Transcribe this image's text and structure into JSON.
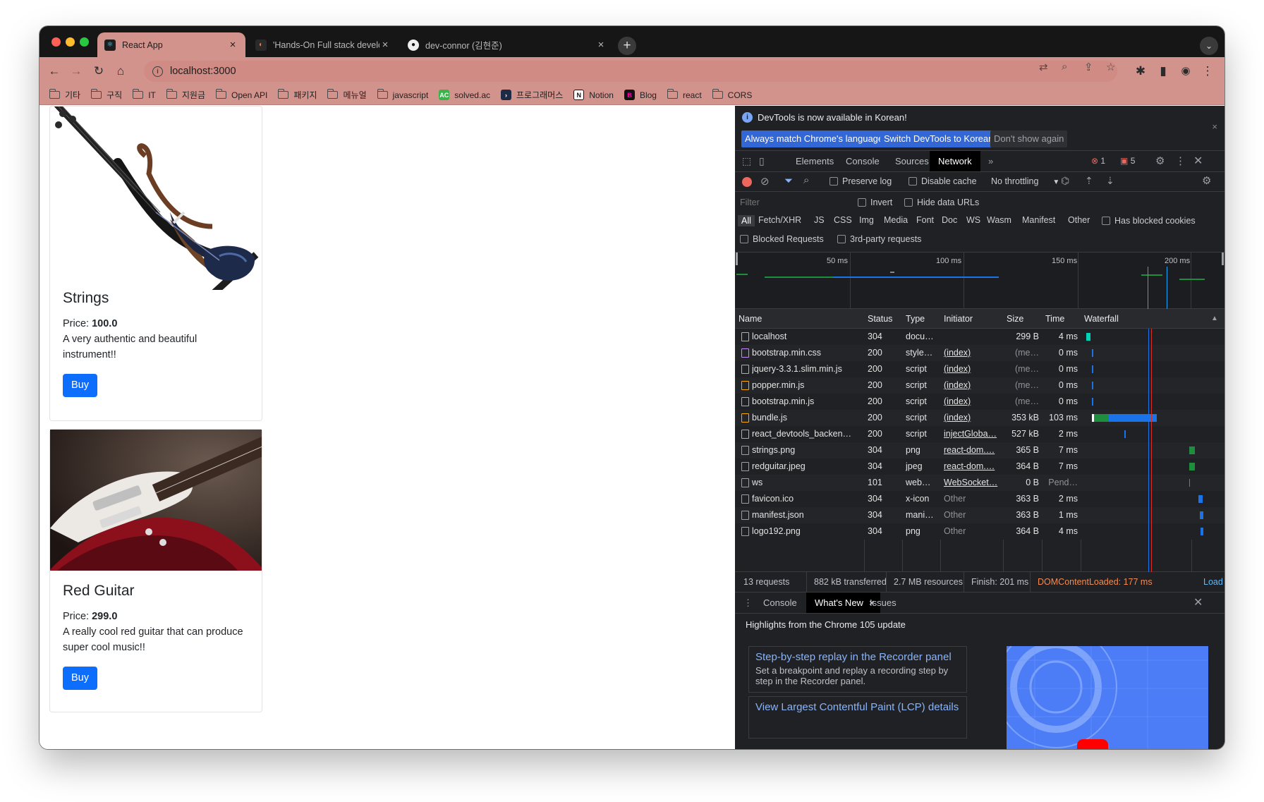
{
  "browser": {
    "tabs": [
      {
        "title": "React App",
        "active": true
      },
      {
        "title": "'Hands-On Full stack developm",
        "active": false
      },
      {
        "title": "dev-connor (김현준)",
        "active": false
      }
    ],
    "address": "localhost:3000",
    "bookmarks": [
      {
        "label": "기타",
        "icon": "folder-icon"
      },
      {
        "label": "구직",
        "icon": "folder-icon"
      },
      {
        "label": "IT",
        "icon": "folder-icon"
      },
      {
        "label": "지원금",
        "icon": "folder-icon"
      },
      {
        "label": "Open API",
        "icon": "folder-icon"
      },
      {
        "label": "패키지",
        "icon": "folder-icon"
      },
      {
        "label": "메뉴얼",
        "icon": "folder-icon"
      },
      {
        "label": "javascript",
        "icon": "folder-icon"
      },
      {
        "label": "solved.ac",
        "icon": "solvedac-icon"
      },
      {
        "label": "프로그래머스",
        "icon": "programmers-icon"
      },
      {
        "label": "Notion",
        "icon": "notion-icon"
      },
      {
        "label": "Blog",
        "icon": "blog-icon"
      },
      {
        "label": "react",
        "icon": "folder-icon"
      },
      {
        "label": "CORS",
        "icon": "folder-icon"
      }
    ]
  },
  "products": [
    {
      "name": "Strings",
      "price_label": "Price: ",
      "price": "100.0",
      "description": "A very authentic and beautiful instrument!!",
      "buy": "Buy"
    },
    {
      "name": "Red Guitar",
      "price_label": "Price: ",
      "price": "299.0",
      "description": "A really cool red guitar that can produce super cool music!!",
      "buy": "Buy"
    }
  ],
  "devtools": {
    "infobar": {
      "message": "DevTools is now available in Korean!",
      "btn_match": "Always match Chrome's language",
      "btn_switch": "Switch DevTools to Korean",
      "btn_dont": "Don't show again"
    },
    "tabs": [
      "Elements",
      "Console",
      "Sources",
      "Network"
    ],
    "active_tab": "Network",
    "errors": "1",
    "issues": "5",
    "toolbar": {
      "preserve_log": "Preserve log",
      "disable_cache": "Disable cache",
      "throttling": "No throttling"
    },
    "filter": {
      "placeholder": "Filter",
      "invert": "Invert",
      "hide_data_urls": "Hide data URLs",
      "types": [
        "All",
        "Fetch/XHR",
        "JS",
        "CSS",
        "Img",
        "Media",
        "Font",
        "Doc",
        "WS",
        "Wasm",
        "Manifest",
        "Other"
      ],
      "has_blocked_cookies": "Has blocked cookies",
      "blocked_requests": "Blocked Requests",
      "third_party": "3rd-party requests"
    },
    "overview_ticks": [
      "50 ms",
      "100 ms",
      "150 ms",
      "200 ms"
    ],
    "columns": [
      "Name",
      "Status",
      "Type",
      "Initiator",
      "Size",
      "Time",
      "Waterfall"
    ],
    "requests": [
      {
        "name": "localhost",
        "status": "304",
        "type": "docu…",
        "initiator": "",
        "size": "299 B",
        "time": "4 ms",
        "icon": "document-icon"
      },
      {
        "name": "bootstrap.min.css",
        "status": "200",
        "type": "style…",
        "initiator": "(index)",
        "size": "(me…",
        "time": "0 ms",
        "icon": "stylesheet-icon"
      },
      {
        "name": "jquery-3.3.1.slim.min.js",
        "status": "200",
        "type": "script",
        "initiator": "(index)",
        "size": "(me…",
        "time": "0 ms",
        "icon": "script-icon"
      },
      {
        "name": "popper.min.js",
        "status": "200",
        "type": "script",
        "initiator": "(index)",
        "size": "(me…",
        "time": "0 ms",
        "icon": "script-icon"
      },
      {
        "name": "bootstrap.min.js",
        "status": "200",
        "type": "script",
        "initiator": "(index)",
        "size": "(me…",
        "time": "0 ms",
        "icon": "script-icon"
      },
      {
        "name": "bundle.js",
        "status": "200",
        "type": "script",
        "initiator": "(index)",
        "size": "353 kB",
        "time": "103 ms",
        "icon": "script-icon"
      },
      {
        "name": "react_devtools_backen…",
        "status": "200",
        "type": "script",
        "initiator": "injectGloba…",
        "size": "527 kB",
        "time": "2 ms",
        "icon": "script-icon"
      },
      {
        "name": "strings.png",
        "status": "304",
        "type": "png",
        "initiator": "react-dom.…",
        "size": "365 B",
        "time": "7 ms",
        "icon": "image-icon"
      },
      {
        "name": "redguitar.jpeg",
        "status": "304",
        "type": "jpeg",
        "initiator": "react-dom.…",
        "size": "364 B",
        "time": "7 ms",
        "icon": "image-icon"
      },
      {
        "name": "ws",
        "status": "101",
        "type": "web…",
        "initiator": "WebSocket…",
        "size": "0 B",
        "time": "Pend…",
        "icon": "websocket-icon"
      },
      {
        "name": "favicon.ico",
        "status": "304",
        "type": "x-icon",
        "initiator": "Other",
        "size": "363 B",
        "time": "2 ms",
        "icon": "file-icon"
      },
      {
        "name": "manifest.json",
        "status": "304",
        "type": "mani…",
        "initiator": "Other",
        "size": "363 B",
        "time": "1 ms",
        "icon": "file-icon"
      },
      {
        "name": "logo192.png",
        "status": "304",
        "type": "png",
        "initiator": "Other",
        "size": "364 B",
        "time": "4 ms",
        "icon": "file-icon"
      }
    ],
    "summary": {
      "requests": "13 requests",
      "transferred": "882 kB transferred",
      "resources": "2.7 MB resources",
      "finish": "Finish: 201 ms",
      "dcl": "DOMContentLoaded: 177 ms",
      "load": "Load"
    },
    "drawer_tabs": [
      "Console",
      "What's New",
      "Issues"
    ],
    "whats_new": {
      "headline": "Highlights from the Chrome 105 update",
      "items": [
        {
          "title": "Step-by-step replay in the Recorder panel",
          "desc": "Set a breakpoint and replay a recording step by step in the Recorder panel."
        },
        {
          "title": "View Largest Contentful Paint (LCP) details",
          "desc": ""
        }
      ]
    }
  }
}
